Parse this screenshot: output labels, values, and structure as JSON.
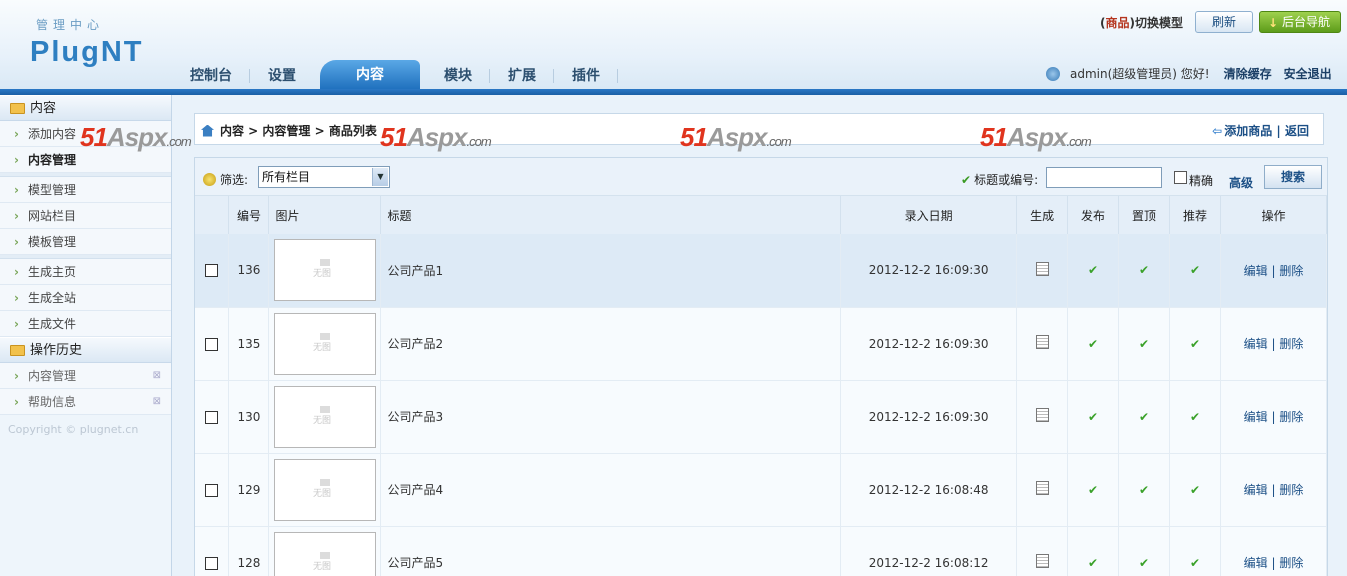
{
  "header": {
    "logo_sub": "管理中心",
    "logo": "PlugNT",
    "model_prefix": "(",
    "model_name": "商品",
    "model_suffix": ")切换模型",
    "refresh_label": "刷新",
    "nav_label": "后台导航",
    "nav": [
      {
        "label": "控制台",
        "active": false
      },
      {
        "label": "设置",
        "active": false
      },
      {
        "label": "内容",
        "active": true
      },
      {
        "label": "模块",
        "active": false
      },
      {
        "label": "扩展",
        "active": false
      },
      {
        "label": "插件",
        "active": false
      }
    ],
    "user_text": "admin(超级管理员) 您好!",
    "clear_cache": "清除缓存",
    "logout": "安全退出"
  },
  "sidebar": {
    "section1": "内容",
    "items1": [
      "添加内容",
      "内容管理"
    ],
    "items2": [
      "模型管理",
      "网站栏目",
      "模板管理"
    ],
    "items3": [
      "生成主页",
      "生成全站",
      "生成文件"
    ],
    "section2": "操作历史",
    "history": [
      "内容管理",
      "帮助信息"
    ],
    "copyright": "Copyright © plugnet.cn"
  },
  "breadcrumb": {
    "text": "内容 > 内容管理 > 商品列表",
    "add_label": "添加商品",
    "back_label": "返回"
  },
  "watermark": {
    "a": "51",
    "b": "Aspx",
    "c": ".com"
  },
  "filter": {
    "label": "筛选:",
    "selected": "所有栏目",
    "search_label": "标题或编号:",
    "search_value": "",
    "exact_label": "精确",
    "advanced_label": "高级",
    "search_button": "搜索"
  },
  "table": {
    "headers": {
      "id": "编号",
      "image": "图片",
      "title": "标题",
      "date": "录入日期",
      "generate": "生成",
      "publish": "发布",
      "top": "置顶",
      "recommend": "推荐",
      "ops": "操作"
    },
    "no_image": "无图",
    "edit": "编辑",
    "delete": "删除",
    "rows": [
      {
        "id": "136",
        "title": "公司产品1",
        "date": "2012-12-2 16:09:30"
      },
      {
        "id": "135",
        "title": "公司产品2",
        "date": "2012-12-2 16:09:30"
      },
      {
        "id": "130",
        "title": "公司产品3",
        "date": "2012-12-2 16:09:30"
      },
      {
        "id": "129",
        "title": "公司产品4",
        "date": "2012-12-2 16:08:48"
      },
      {
        "id": "128",
        "title": "公司产品5",
        "date": "2012-12-2 16:08:12"
      }
    ]
  }
}
